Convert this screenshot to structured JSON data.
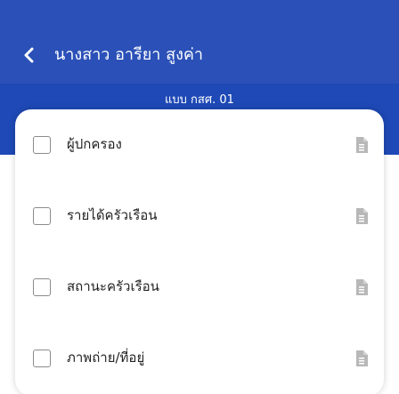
{
  "header": {
    "title": "นางสาว อารียา สูงค่า",
    "subtitle": "แบบ กสศ. 01",
    "back_icon": "chevron-left-icon",
    "colors": {
      "appbar": "#2b51b8",
      "subbar": "#1e49b6"
    }
  },
  "checklist": {
    "items": [
      {
        "label": "ผู้ปกครอง",
        "checked": false,
        "icon": "document-icon"
      },
      {
        "label": "รายได้ครัวเรือน",
        "checked": false,
        "icon": "document-icon"
      },
      {
        "label": "สถานะครัวเรือน",
        "checked": false,
        "icon": "document-icon"
      },
      {
        "label": "ภาพถ่าย/ที่อยู่",
        "checked": false,
        "icon": "document-icon"
      }
    ]
  }
}
